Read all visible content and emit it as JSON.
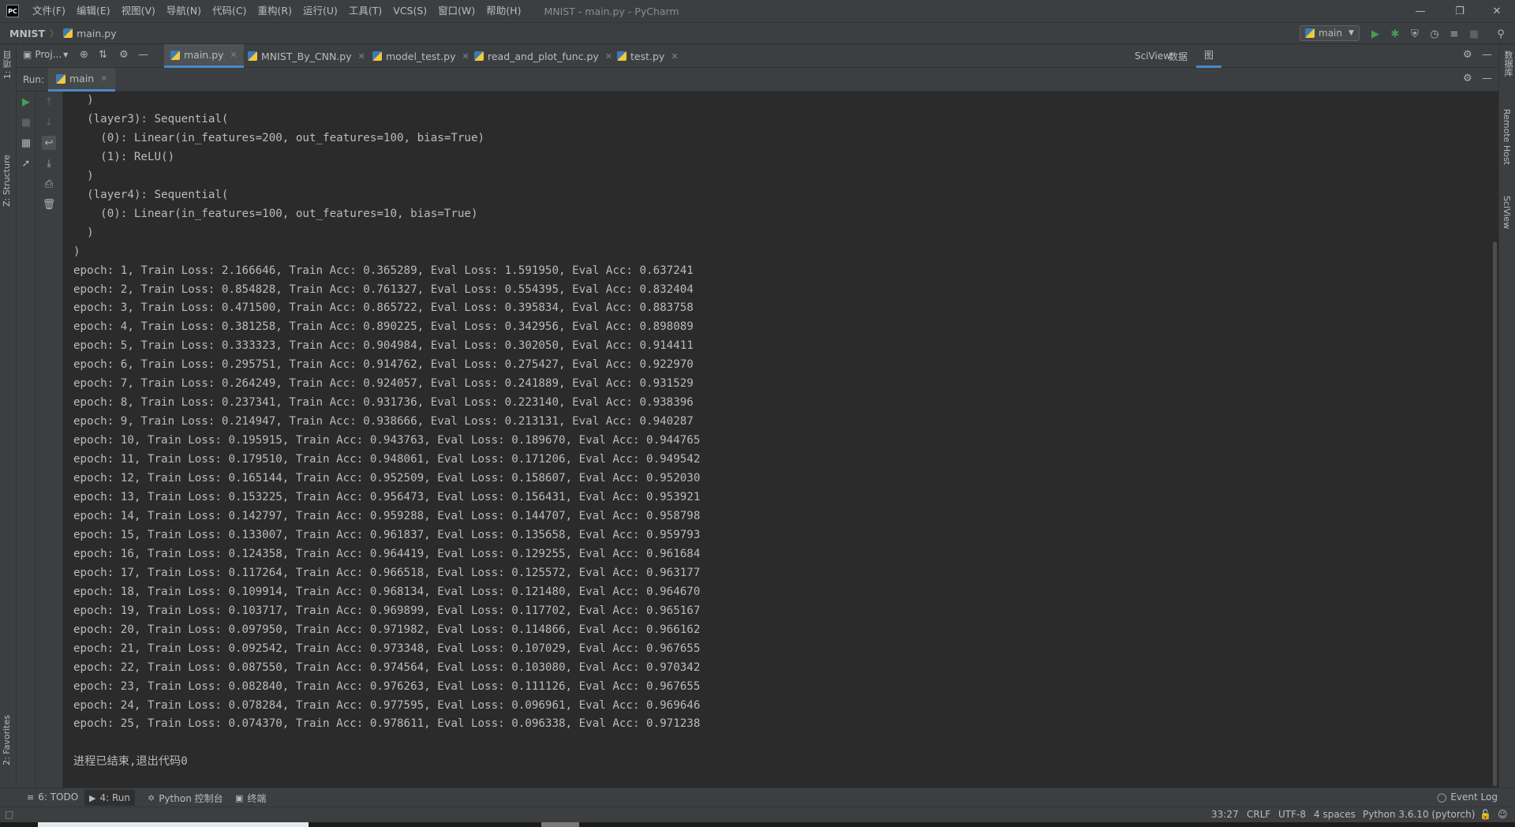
{
  "app": {
    "logo": "PC",
    "window_title": "MNIST - main.py - PyCharm",
    "menu": [
      "文件(F)",
      "编辑(E)",
      "视图(V)",
      "导航(N)",
      "代码(C)",
      "重构(R)",
      "运行(U)",
      "工具(T)",
      "VCS(S)",
      "窗口(W)",
      "帮助(H)"
    ]
  },
  "navbar": {
    "project": "MNIST",
    "separator": "〉",
    "file": "main.py",
    "run_config": "main"
  },
  "left_tool_tabs": {
    "project": "1: 项目",
    "structure": "Z: Structure",
    "favorites": "2: Favorites"
  },
  "right_tool_tabs": {
    "database": "数据库",
    "remote_host": "Remote Host",
    "sciview": "SciView"
  },
  "editor_tabs": {
    "project_pane": "Proj...",
    "tabs": [
      "main.py",
      "MNIST_By_CNN.py",
      "model_test.py",
      "read_and_plot_func.py",
      "test.py"
    ],
    "active_index": 0
  },
  "sciview": {
    "label": "SciView:",
    "data_tab": "数据",
    "plot_tab": "图"
  },
  "run": {
    "label": "Run:",
    "tab": "main"
  },
  "console": {
    "lines": [
      "  )",
      "  (layer3): Sequential(",
      "    (0): Linear(in_features=200, out_features=100, bias=True)",
      "    (1): ReLU()",
      "  )",
      "  (layer4): Sequential(",
      "    (0): Linear(in_features=100, out_features=10, bias=True)",
      "  )",
      ")",
      "epoch: 1, Train Loss: 2.166646, Train Acc: 0.365289, Eval Loss: 1.591950, Eval Acc: 0.637241",
      "epoch: 2, Train Loss: 0.854828, Train Acc: 0.761327, Eval Loss: 0.554395, Eval Acc: 0.832404",
      "epoch: 3, Train Loss: 0.471500, Train Acc: 0.865722, Eval Loss: 0.395834, Eval Acc: 0.883758",
      "epoch: 4, Train Loss: 0.381258, Train Acc: 0.890225, Eval Loss: 0.342956, Eval Acc: 0.898089",
      "epoch: 5, Train Loss: 0.333323, Train Acc: 0.904984, Eval Loss: 0.302050, Eval Acc: 0.914411",
      "epoch: 6, Train Loss: 0.295751, Train Acc: 0.914762, Eval Loss: 0.275427, Eval Acc: 0.922970",
      "epoch: 7, Train Loss: 0.264249, Train Acc: 0.924057, Eval Loss: 0.241889, Eval Acc: 0.931529",
      "epoch: 8, Train Loss: 0.237341, Train Acc: 0.931736, Eval Loss: 0.223140, Eval Acc: 0.938396",
      "epoch: 9, Train Loss: 0.214947, Train Acc: 0.938666, Eval Loss: 0.213131, Eval Acc: 0.940287",
      "epoch: 10, Train Loss: 0.195915, Train Acc: 0.943763, Eval Loss: 0.189670, Eval Acc: 0.944765",
      "epoch: 11, Train Loss: 0.179510, Train Acc: 0.948061, Eval Loss: 0.171206, Eval Acc: 0.949542",
      "epoch: 12, Train Loss: 0.165144, Train Acc: 0.952509, Eval Loss: 0.158607, Eval Acc: 0.952030",
      "epoch: 13, Train Loss: 0.153225, Train Acc: 0.956473, Eval Loss: 0.156431, Eval Acc: 0.953921",
      "epoch: 14, Train Loss: 0.142797, Train Acc: 0.959288, Eval Loss: 0.144707, Eval Acc: 0.958798",
      "epoch: 15, Train Loss: 0.133007, Train Acc: 0.961837, Eval Loss: 0.135658, Eval Acc: 0.959793",
      "epoch: 16, Train Loss: 0.124358, Train Acc: 0.964419, Eval Loss: 0.129255, Eval Acc: 0.961684",
      "epoch: 17, Train Loss: 0.117264, Train Acc: 0.966518, Eval Loss: 0.125572, Eval Acc: 0.963177",
      "epoch: 18, Train Loss: 0.109914, Train Acc: 0.968134, Eval Loss: 0.121480, Eval Acc: 0.964670",
      "epoch: 19, Train Loss: 0.103717, Train Acc: 0.969899, Eval Loss: 0.117702, Eval Acc: 0.965167",
      "epoch: 20, Train Loss: 0.097950, Train Acc: 0.971982, Eval Loss: 0.114866, Eval Acc: 0.966162",
      "epoch: 21, Train Loss: 0.092542, Train Acc: 0.973348, Eval Loss: 0.107029, Eval Acc: 0.967655",
      "epoch: 22, Train Loss: 0.087550, Train Acc: 0.974564, Eval Loss: 0.103080, Eval Acc: 0.970342",
      "epoch: 23, Train Loss: 0.082840, Train Acc: 0.976263, Eval Loss: 0.111126, Eval Acc: 0.967655",
      "epoch: 24, Train Loss: 0.078284, Train Acc: 0.977595, Eval Loss: 0.096961, Eval Acc: 0.969646",
      "epoch: 25, Train Loss: 0.074370, Train Acc: 0.978611, Eval Loss: 0.096338, Eval Acc: 0.971238",
      "",
      "进程已结束,退出代码0"
    ]
  },
  "bottom_tools": {
    "todo": "6: TODO",
    "run": "4: Run",
    "python_console": "Python 控制台",
    "terminal": "终端",
    "event_log": "Event Log"
  },
  "status": {
    "position": "33:27",
    "line_sep": "CRLF",
    "encoding": "UTF-8",
    "indent": "4 spaces",
    "interpreter": "Python 3.6.10 (pytorch)"
  },
  "colors": {
    "accent": "#4a88c7",
    "run_green": "#499c54",
    "bg": "#2b2b2b",
    "panel": "#3c3f41"
  }
}
